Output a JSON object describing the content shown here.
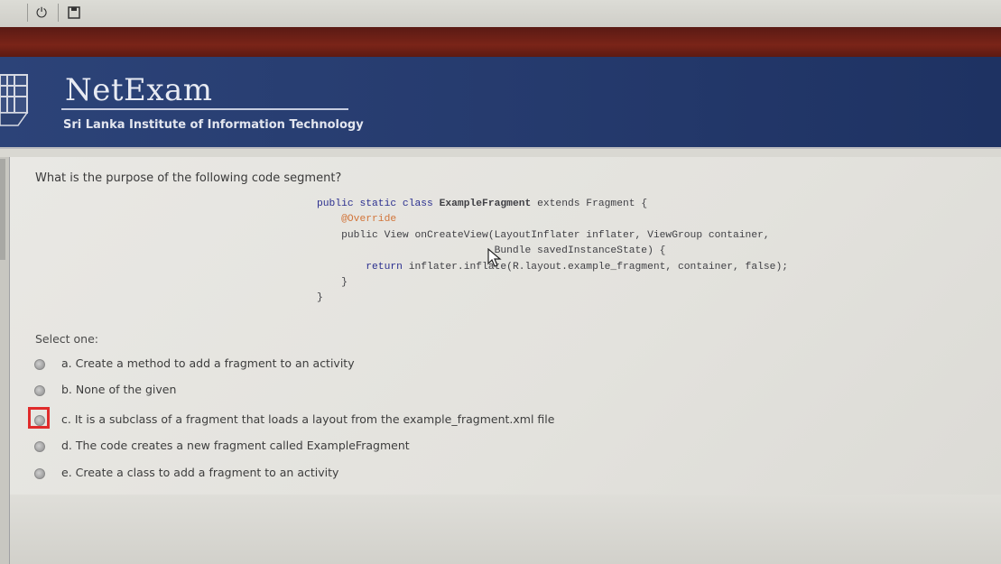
{
  "header": {
    "site_title": "NetExam",
    "site_subtitle": "Sri Lanka Institute of Information Technology"
  },
  "question": {
    "text": "What is the purpose of the following code segment?",
    "code": [
      "public static class ExampleFragment extends Fragment {",
      "    @Override",
      "    public View onCreateView(LayoutInflater inflater, ViewGroup container,",
      "                             Bundle savedInstanceState) {",
      "        return inflater.inflate(R.layout.example_fragment, container, false);",
      "    }",
      "}"
    ]
  },
  "answers": {
    "prompt": "Select one:",
    "options": [
      {
        "label": "a. Create a method to add a fragment to an activity"
      },
      {
        "label": "b. None of the given"
      },
      {
        "label": "c. It is a subclass of a fragment that loads a layout from the example_fragment.xml file"
      },
      {
        "label": "d. The code creates a new fragment called ExampleFragment"
      },
      {
        "label": "e. Create a class to add a fragment to an activity"
      }
    ]
  },
  "colors": {
    "header_blue": "#2c4378",
    "accent_red": "#7a2418",
    "highlight_red": "#e02b2b"
  },
  "icons": [
    "power-icon",
    "save-icon",
    "cursor-icon",
    "crest-logo"
  ]
}
